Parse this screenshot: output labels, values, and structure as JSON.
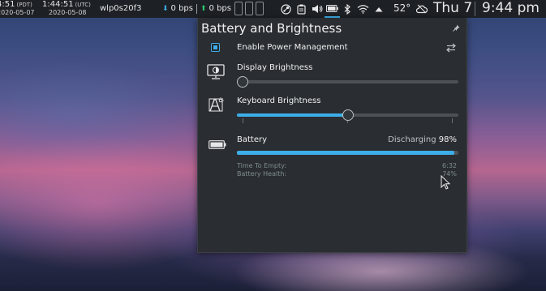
{
  "panel": {
    "clock_pdt": {
      "time": "4:51",
      "tz": "(PDT)",
      "date": "2020-05-07"
    },
    "clock_utc": {
      "time": "1:44:51",
      "tz": "(UTC)",
      "date": "2020-05-08"
    },
    "interface": "wlp0s20f3",
    "net_down": "0 bps",
    "net_up": "0 bps",
    "tray_icons": [
      "steam-icon",
      "clipboard-icon",
      "volume-icon",
      "battery-icon",
      "bluetooth-icon",
      "wifi-icon",
      "expand-arrow-icon"
    ],
    "temperature": "52°",
    "day": "Thu 7",
    "time": "9:44 pm",
    "accent": "#3daee9"
  },
  "popup": {
    "title": "Battery and Brightness",
    "power_management": {
      "label": "Enable Power Management",
      "checked": true
    },
    "display_brightness": {
      "label": "Display Brightness",
      "level": 0
    },
    "keyboard_brightness": {
      "label": "Keyboard Brightness",
      "level": 0.5
    },
    "battery": {
      "label": "Battery",
      "status": "Discharging",
      "percent_text": "98%",
      "level": 0.98,
      "time_label": "Time To Empty:",
      "time_value": "6:32",
      "health_label": "Battery Health:",
      "health_value": "74%"
    }
  }
}
